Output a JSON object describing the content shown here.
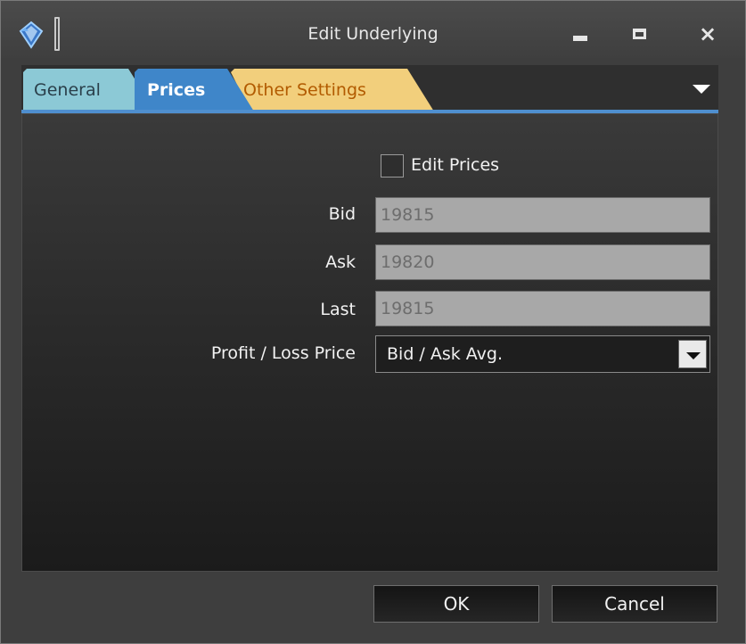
{
  "window": {
    "title": "Edit Underlying",
    "icons": {
      "app": "diamond-gem-icon",
      "minimize": "minimize-icon",
      "maximize": "maximize-icon",
      "close": "close-icon",
      "tab_menu": "chevron-down-icon",
      "select_arrow": "chevron-down-icon"
    },
    "close_glyph": "×"
  },
  "tabs": [
    {
      "label": "General",
      "color": "#8cc9d6",
      "active": false
    },
    {
      "label": "Prices",
      "color": "#3f86c9",
      "active": true
    },
    {
      "label": "Other Settings",
      "color": "#f2cf7c",
      "active": false
    }
  ],
  "form": {
    "edit_prices_label": "Edit Prices",
    "edit_prices_checked": false,
    "bid_label": "Bid",
    "bid_value": "19815",
    "ask_label": "Ask",
    "ask_value": "19820",
    "last_label": "Last",
    "last_value": "19815",
    "pl_label": "Profit / Loss Price",
    "pl_value": "Bid / Ask Avg."
  },
  "buttons": {
    "ok": "OK",
    "cancel": "Cancel"
  },
  "colors": {
    "accent": "#4f8fcf",
    "disabled_field": "#a8a8a8"
  }
}
